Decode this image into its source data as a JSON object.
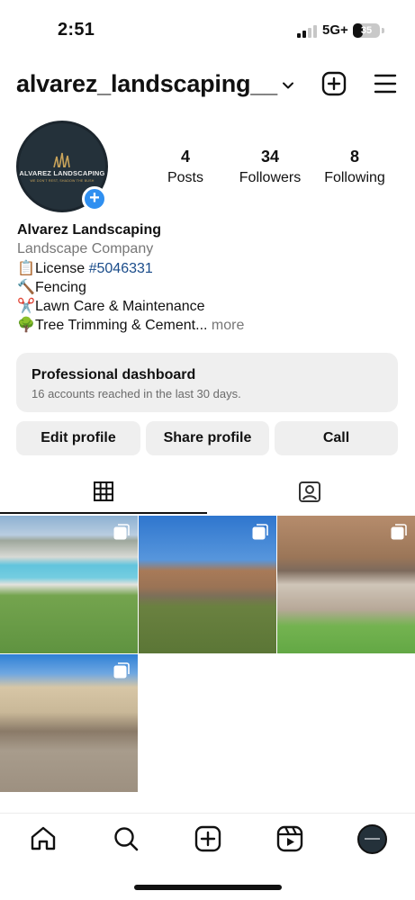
{
  "status_bar": {
    "time": "2:51",
    "network": "5G+",
    "battery": "35",
    "battery_level": 0.35
  },
  "header": {
    "username": "alvarez_landscaping__"
  },
  "profile": {
    "avatar_text": "ALVAREZ LANDSCAPING",
    "avatar_tagline": "WE DON'T REST, SHADOW THE BUSH",
    "stats": [
      {
        "value": "4",
        "label": "Posts"
      },
      {
        "value": "34",
        "label": "Followers"
      },
      {
        "value": "8",
        "label": "Following"
      }
    ],
    "name": "Alvarez Landscaping",
    "category": "Landscape Company",
    "bio": {
      "license_prefix": "License ",
      "license_link": "#5046331",
      "fencing": "Fencing",
      "lawn": "Lawn Care & Maintenance",
      "tree": "Tree Trimming & Cement...",
      "more": " more"
    },
    "emojis": {
      "license": "📋",
      "fencing": "🔨",
      "lawn": "✂️",
      "tree": "🌳"
    }
  },
  "dashboard": {
    "title": "Professional dashboard",
    "subtitle": "16 accounts reached in the last 30 days."
  },
  "buttons": {
    "edit": "Edit profile",
    "share": "Share profile",
    "call": "Call"
  },
  "tabs": [
    "grid-icon",
    "tagged-icon"
  ],
  "nav": [
    "home-icon",
    "search-icon",
    "create-icon",
    "reels-icon",
    "profile-avatar"
  ],
  "colors": {
    "accent": "#2f8ff0",
    "link": "#1a4c8a",
    "button_bg": "#efefef"
  }
}
